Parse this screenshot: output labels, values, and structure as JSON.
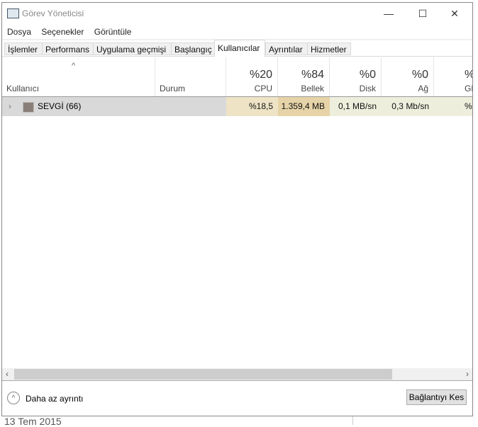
{
  "window": {
    "title": "Görev Yöneticisi",
    "minimize": "—",
    "maximize": "☐",
    "close": "✕"
  },
  "menu": [
    "Dosya",
    "Seçenekler",
    "Görüntüle"
  ],
  "tabs": [
    "İşlemler",
    "Performans",
    "Uygulama geçmişi",
    "Başlangıç",
    "Kullanıcılar",
    "Ayrıntılar",
    "Hizmetler"
  ],
  "active_tab": "Kullanıcılar",
  "columns": {
    "user": "Kullanıcı",
    "status": "Durum",
    "cpu": {
      "pct": "%20",
      "label": "CPU"
    },
    "mem": {
      "pct": "%84",
      "label": "Bellek"
    },
    "disk": {
      "pct": "%0",
      "label": "Disk"
    },
    "net": {
      "pct": "%0",
      "label": "Ağ"
    },
    "gpu": {
      "pct": "%",
      "label": "GP"
    }
  },
  "rows": [
    {
      "user": "SEVGİ (66)",
      "status": "",
      "cpu": "%18,5",
      "mem": "1.359,4 MB",
      "disk": "0,1 MB/sn",
      "net": "0,3 Mb/sn",
      "gpu": "%"
    }
  ],
  "heat_colors": {
    "cpu": "#eee3c5",
    "mem": "#e6d3a8",
    "disk": "#eeeedd",
    "net": "#eeeedd"
  },
  "footer": {
    "less_details": "Daha az ayrıntı",
    "disconnect": "Bağlantıyı Kes"
  },
  "background": {
    "date": "13 Tem 2015"
  }
}
